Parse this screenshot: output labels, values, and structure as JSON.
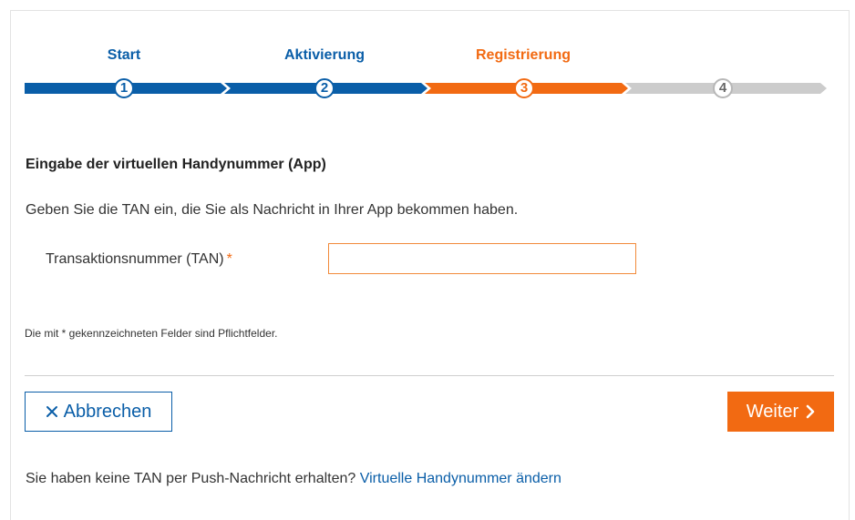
{
  "colors": {
    "blue": "#0a5ea8",
    "orange": "#f26a12",
    "grey": "#cccccc"
  },
  "stepper": {
    "steps": [
      {
        "label": "Start",
        "number": "1",
        "state": "completed"
      },
      {
        "label": "Aktivierung",
        "number": "2",
        "state": "completed"
      },
      {
        "label": "Registrierung",
        "number": "3",
        "state": "active"
      },
      {
        "label": "",
        "number": "4",
        "state": "pending"
      }
    ]
  },
  "form": {
    "heading": "Eingabe der virtuellen Handynummer (App)",
    "instruction": "Geben Sie die TAN ein, die Sie als Nachricht in Ihrer App bekommen haben.",
    "tan_label": "Transaktionsnummer (TAN)",
    "required_marker": "*",
    "tan_value": "",
    "required_note": "Die mit * gekennzeichneten Felder sind Pflichtfelder."
  },
  "actions": {
    "cancel_label": "Abbrechen",
    "cancel_icon": "close-icon",
    "next_label": "Weiter",
    "next_icon": "chevron-right-icon"
  },
  "footer": {
    "text": "Sie haben keine TAN per Push-Nachricht erhalten?",
    "link_label": "Virtuelle Handynummer ändern"
  }
}
